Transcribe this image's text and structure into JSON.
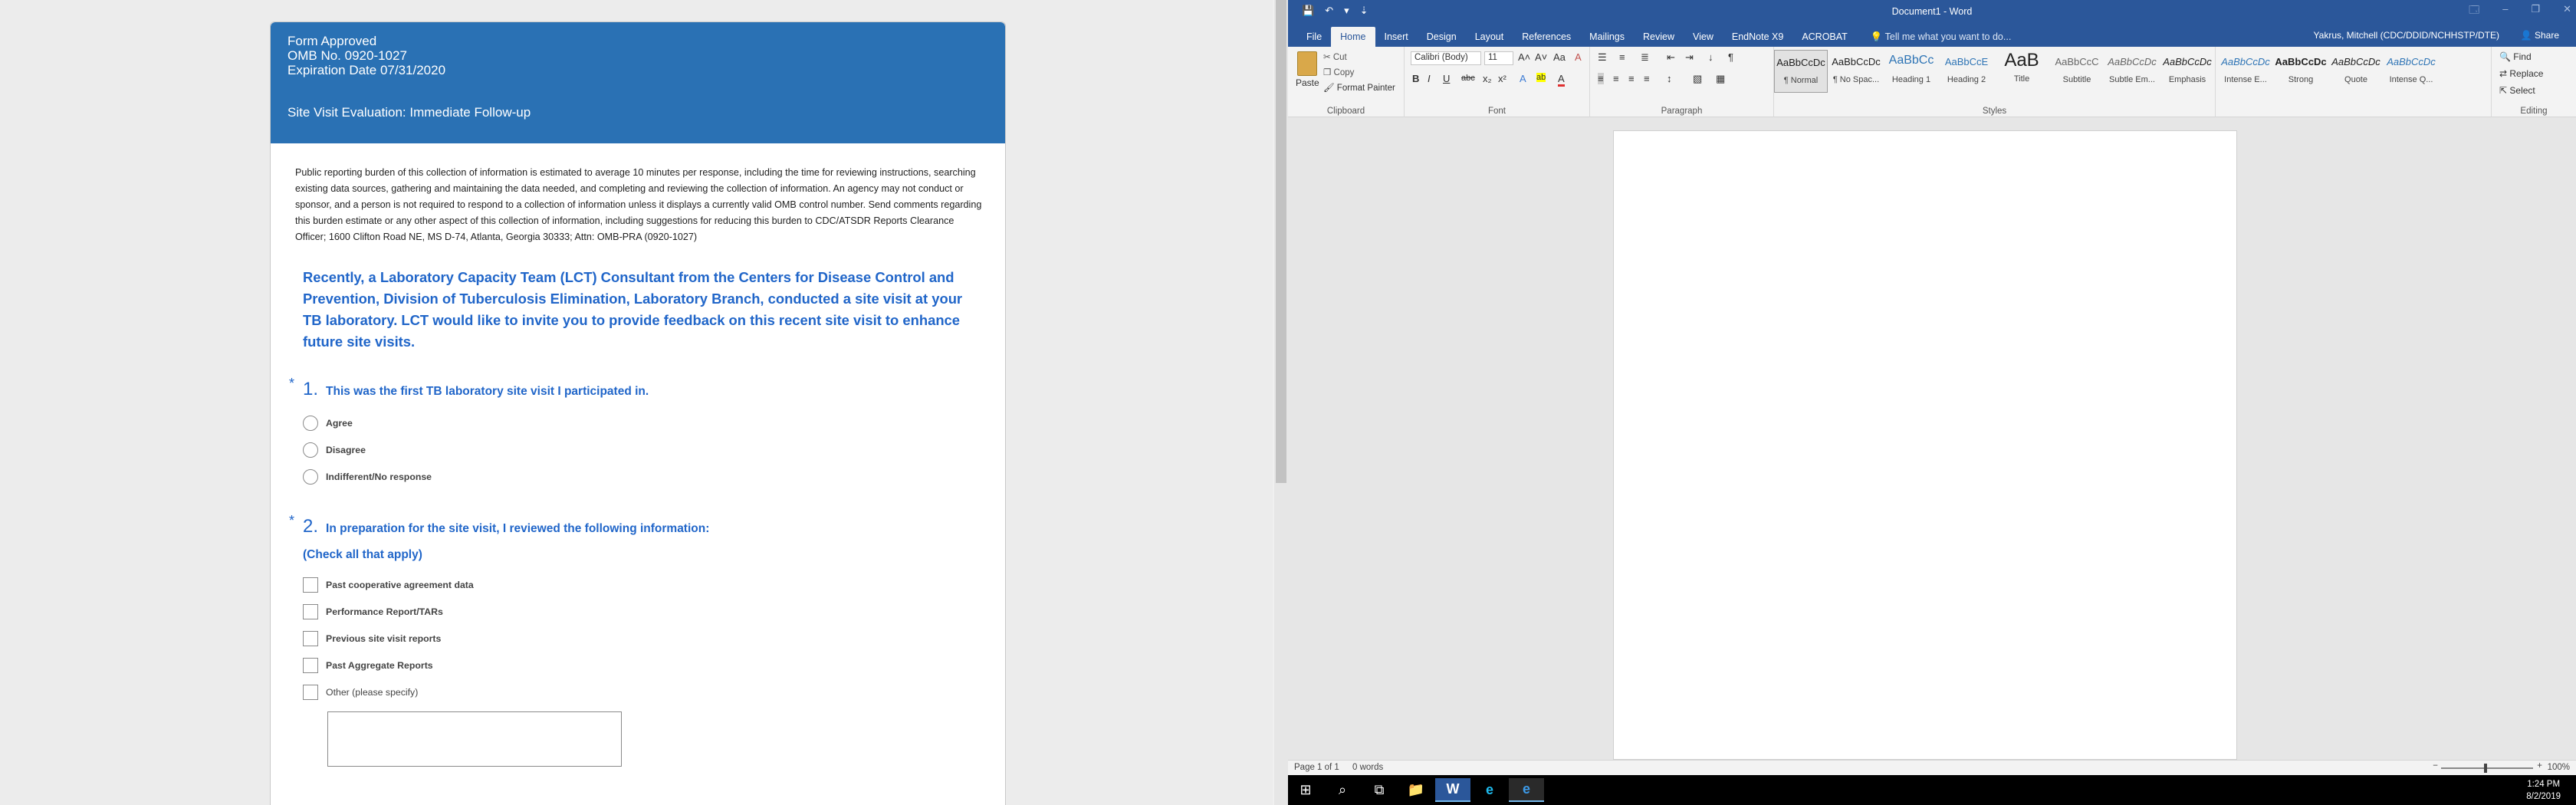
{
  "survey": {
    "header": {
      "form_approved": "Form Approved",
      "omb_no": "OMB No. 0920-1027",
      "expiration": "Expiration Date 07/31/2020",
      "title": "Site Visit Evaluation: Immediate Follow-up"
    },
    "burden_text": "Public reporting burden of this collection of information is estimated to average 10 minutes per response, including the time for reviewing instructions, searching existing data sources, gathering and maintaining the data needed, and completing and reviewing the collection of information.  An agency may not conduct or sponsor, and a person is not required to respond to a collection of information unless it displays a currently valid OMB control number.  Send comments regarding this burden estimate or any other aspect of this collection of information, including suggestions for reducing this burden to CDC/ATSDR Reports Clearance Officer; 1600 Clifton Road NE, MS D-74, Atlanta, Georgia 30333; Attn: OMB-PRA (0920-1027)",
    "intro_text": "Recently, a Laboratory Capacity Team (LCT) Consultant from the Centers for Disease Control and Prevention, Division of Tuberculosis Elimination, Laboratory Branch, conducted a site visit at your TB laboratory. LCT would like to invite you to provide feedback on this recent site visit to enhance future site visits.",
    "q1": {
      "required_marker": "*",
      "number": "1.",
      "text": "This was the first TB laboratory site visit I participated in.",
      "options": [
        "Agree",
        "Disagree",
        "Indifferent/No response"
      ]
    },
    "q2": {
      "required_marker": "*",
      "number": "2.",
      "text": "In preparation for the site visit, I reviewed the following information:",
      "subtext": "(Check all that apply)",
      "options": [
        "Past cooperative agreement data",
        "Performance Report/TARs",
        "Previous site visit reports",
        "Past Aggregate Reports",
        "Other (please specify)"
      ]
    }
  },
  "word": {
    "window_title": "Document1 - Word",
    "qat": {
      "save": "💾",
      "undo": "↶",
      "undo_menu": "▾",
      "customize": "⇣"
    },
    "window_controls": {
      "ribbon_options": "🗔",
      "minimize": "–",
      "restore": "❐",
      "close": "✕"
    },
    "tabs": [
      "File",
      "Home",
      "Insert",
      "Design",
      "Layout",
      "References",
      "Mailings",
      "Review",
      "View",
      "EndNote X9",
      "ACROBAT"
    ],
    "active_tab": "Home",
    "tell_me": "Tell me what you want to do...",
    "user": "Yakrus, Mitchell (CDC/DDID/NCHHSTP/DTE)",
    "share": "Share",
    "clipboard": {
      "paste": "Paste",
      "cut": "Cut",
      "copy": "Copy",
      "format_painter": "Format Painter",
      "label": "Clipboard"
    },
    "font": {
      "font_name": "Calibri (Body)",
      "font_size": "11",
      "grow": "A˄",
      "shrink": "A˅",
      "change_case": "Aa",
      "clear": "A",
      "bold": "B",
      "italic": "I",
      "underline": "U",
      "strike": "abc",
      "subscript": "x₂",
      "superscript": "x²",
      "effects": "A",
      "highlight": "ab",
      "color": "A",
      "label": "Font"
    },
    "paragraph": {
      "bullets": "☰",
      "numbering": "≡",
      "multilevel": "≣",
      "decrease_indent": "⇤",
      "increase_indent": "⇥",
      "sort": "↓",
      "show_marks": "¶",
      "align_left": "≡",
      "center": "≡",
      "align_right": "≡",
      "justify": "≡",
      "line_spacing": "↕",
      "shading": "▧",
      "borders": "▦",
      "label": "Paragraph"
    },
    "styles": {
      "items": [
        {
          "sample": "AaBbCcDc",
          "name": "¶ Normal"
        },
        {
          "sample": "AaBbCcDc",
          "name": "¶ No Spac..."
        },
        {
          "sample": "AaBbCc",
          "name": "Heading 1"
        },
        {
          "sample": "AaBbCcE",
          "name": "Heading 2"
        },
        {
          "sample": "AaB",
          "name": "Title"
        },
        {
          "sample": "AaBbCcC",
          "name": "Subtitle"
        },
        {
          "sample": "AaBbCcDc",
          "name": "Subtle Em..."
        },
        {
          "sample": "AaBbCcDc",
          "name": "Emphasis"
        },
        {
          "sample": "AaBbCcDc",
          "name": "Intense E..."
        },
        {
          "sample": "AaBbCcDc",
          "name": "Strong"
        },
        {
          "sample": "AaBbCcDc",
          "name": "Quote"
        },
        {
          "sample": "AaBbCcDc",
          "name": "Intense Q..."
        }
      ],
      "label": "Styles"
    },
    "editing": {
      "find": "Find",
      "replace": "Replace",
      "select": "Select",
      "label": "Editing"
    },
    "status": {
      "page": "Page 1 of 1",
      "words": "0 words",
      "zoom": "100%",
      "zoom_minus": "−",
      "zoom_plus": "+"
    }
  },
  "taskbar": {
    "start": "⊞",
    "search": "⌕",
    "task_view": "⧉",
    "explorer": "📁",
    "word": "W",
    "ie": "e",
    "edge": "e",
    "time": "1:24 PM",
    "date": "8/2/2019"
  }
}
